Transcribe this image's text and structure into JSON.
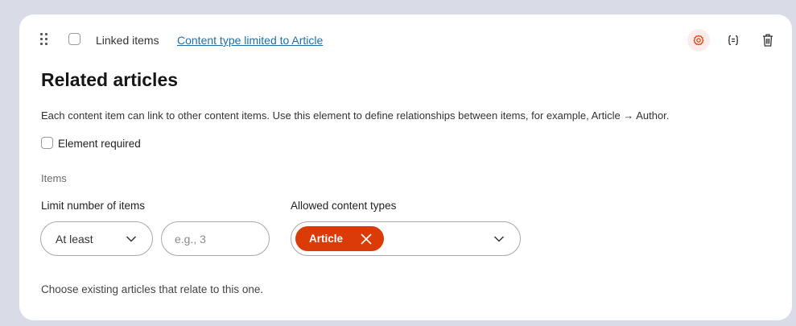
{
  "element": {
    "type_label": "Linked items",
    "limitation_link": "Content type limited to Article",
    "title": "Related articles",
    "guidelines": "Each content item can link to other content items. Use this element to define relationships between items, for example, Article → Author.",
    "required_label": "Element required",
    "section_label": "Items",
    "limit_label": "Limit number of items",
    "limit_select_value": "At least",
    "limit_input_placeholder": "e.g., 3",
    "allowed_types_label": "Allowed content types",
    "allowed_types": [
      {
        "label": "Article"
      }
    ],
    "hint": "Choose existing articles that relate to this one."
  },
  "icons": {
    "drag": "drag-handle-icon",
    "settings": "gear-icon",
    "snippet": "braces-icon",
    "delete": "trash-icon",
    "select_chevron": "chevron-down-icon",
    "tag_remove": "close-icon"
  },
  "colors": {
    "accent": "#db3b06",
    "link": "#1f6fae",
    "settings_bg": "#fdecea",
    "page_bg": "#d9dbe6"
  }
}
